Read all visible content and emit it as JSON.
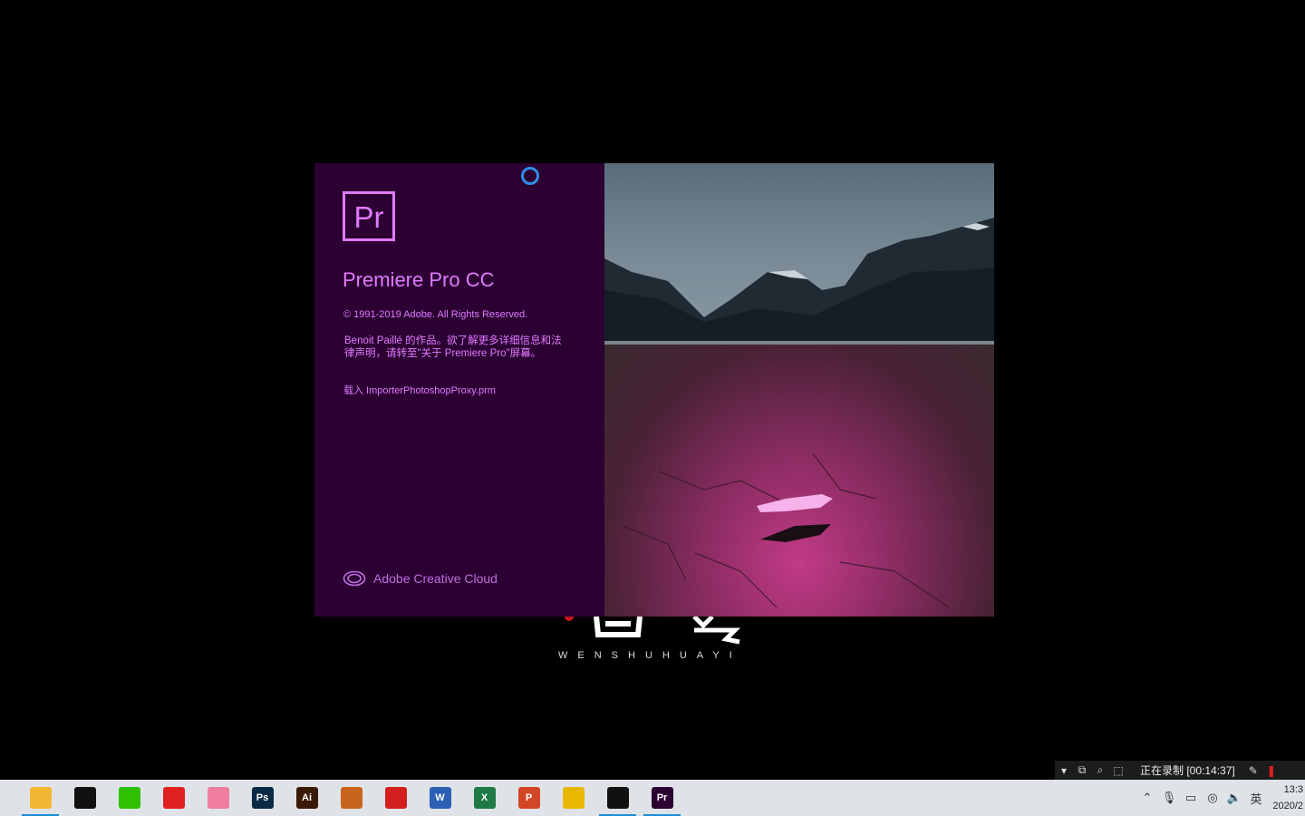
{
  "splash": {
    "logo_text": "Pr",
    "product_name": "Premiere Pro CC",
    "copyright": "© 1991-2019 Adobe. All Rights Reserved.",
    "credits_line1": "Benoit Paillé 的作品。欲了解更多详细信息和法",
    "credits_line2": "律声明，请转至\"关于 Premiere Pro\"屏幕。",
    "loading_text": "载入 ImporterPhotoshopProxy.prm",
    "cc_label": "Adobe Creative Cloud"
  },
  "watermark": {
    "text": "WENSHUHUAYI"
  },
  "recorder": {
    "status": "正在录制 [00:14:37]"
  },
  "taskbar": {
    "apps": [
      {
        "name": "file-explorer",
        "label": "",
        "color": "#f2b632",
        "active": true
      },
      {
        "name": "qq",
        "label": "",
        "color": "#111111",
        "active": false
      },
      {
        "name": "wechat",
        "label": "",
        "color": "#2dc100",
        "active": false
      },
      {
        "name": "netease-music",
        "label": "",
        "color": "#e02020",
        "active": false
      },
      {
        "name": "bilibili",
        "label": "",
        "color": "#f07d9f",
        "active": false
      },
      {
        "name": "photoshop",
        "label": "Ps",
        "color": "#0a2a45",
        "active": false
      },
      {
        "name": "illustrator",
        "label": "Ai",
        "color": "#3a1a05",
        "active": false
      },
      {
        "name": "pencil",
        "label": "",
        "color": "#c8641e",
        "active": false
      },
      {
        "name": "acrobat",
        "label": "",
        "color": "#d41f1f",
        "active": false
      },
      {
        "name": "word",
        "label": "W",
        "color": "#2b5fb4",
        "active": false
      },
      {
        "name": "excel",
        "label": "X",
        "color": "#1f7a45",
        "active": false
      },
      {
        "name": "powerpoint",
        "label": "P",
        "color": "#d24625",
        "active": false
      },
      {
        "name": "chrome",
        "label": "",
        "color": "#e8b800",
        "active": false
      },
      {
        "name": "recorder",
        "label": "",
        "color": "#111111",
        "active": true
      },
      {
        "name": "premiere",
        "label": "Pr",
        "color": "#2c0033",
        "active": true
      }
    ],
    "ime_label": "英",
    "clock_time": "13:3",
    "clock_date": "2020/2"
  }
}
